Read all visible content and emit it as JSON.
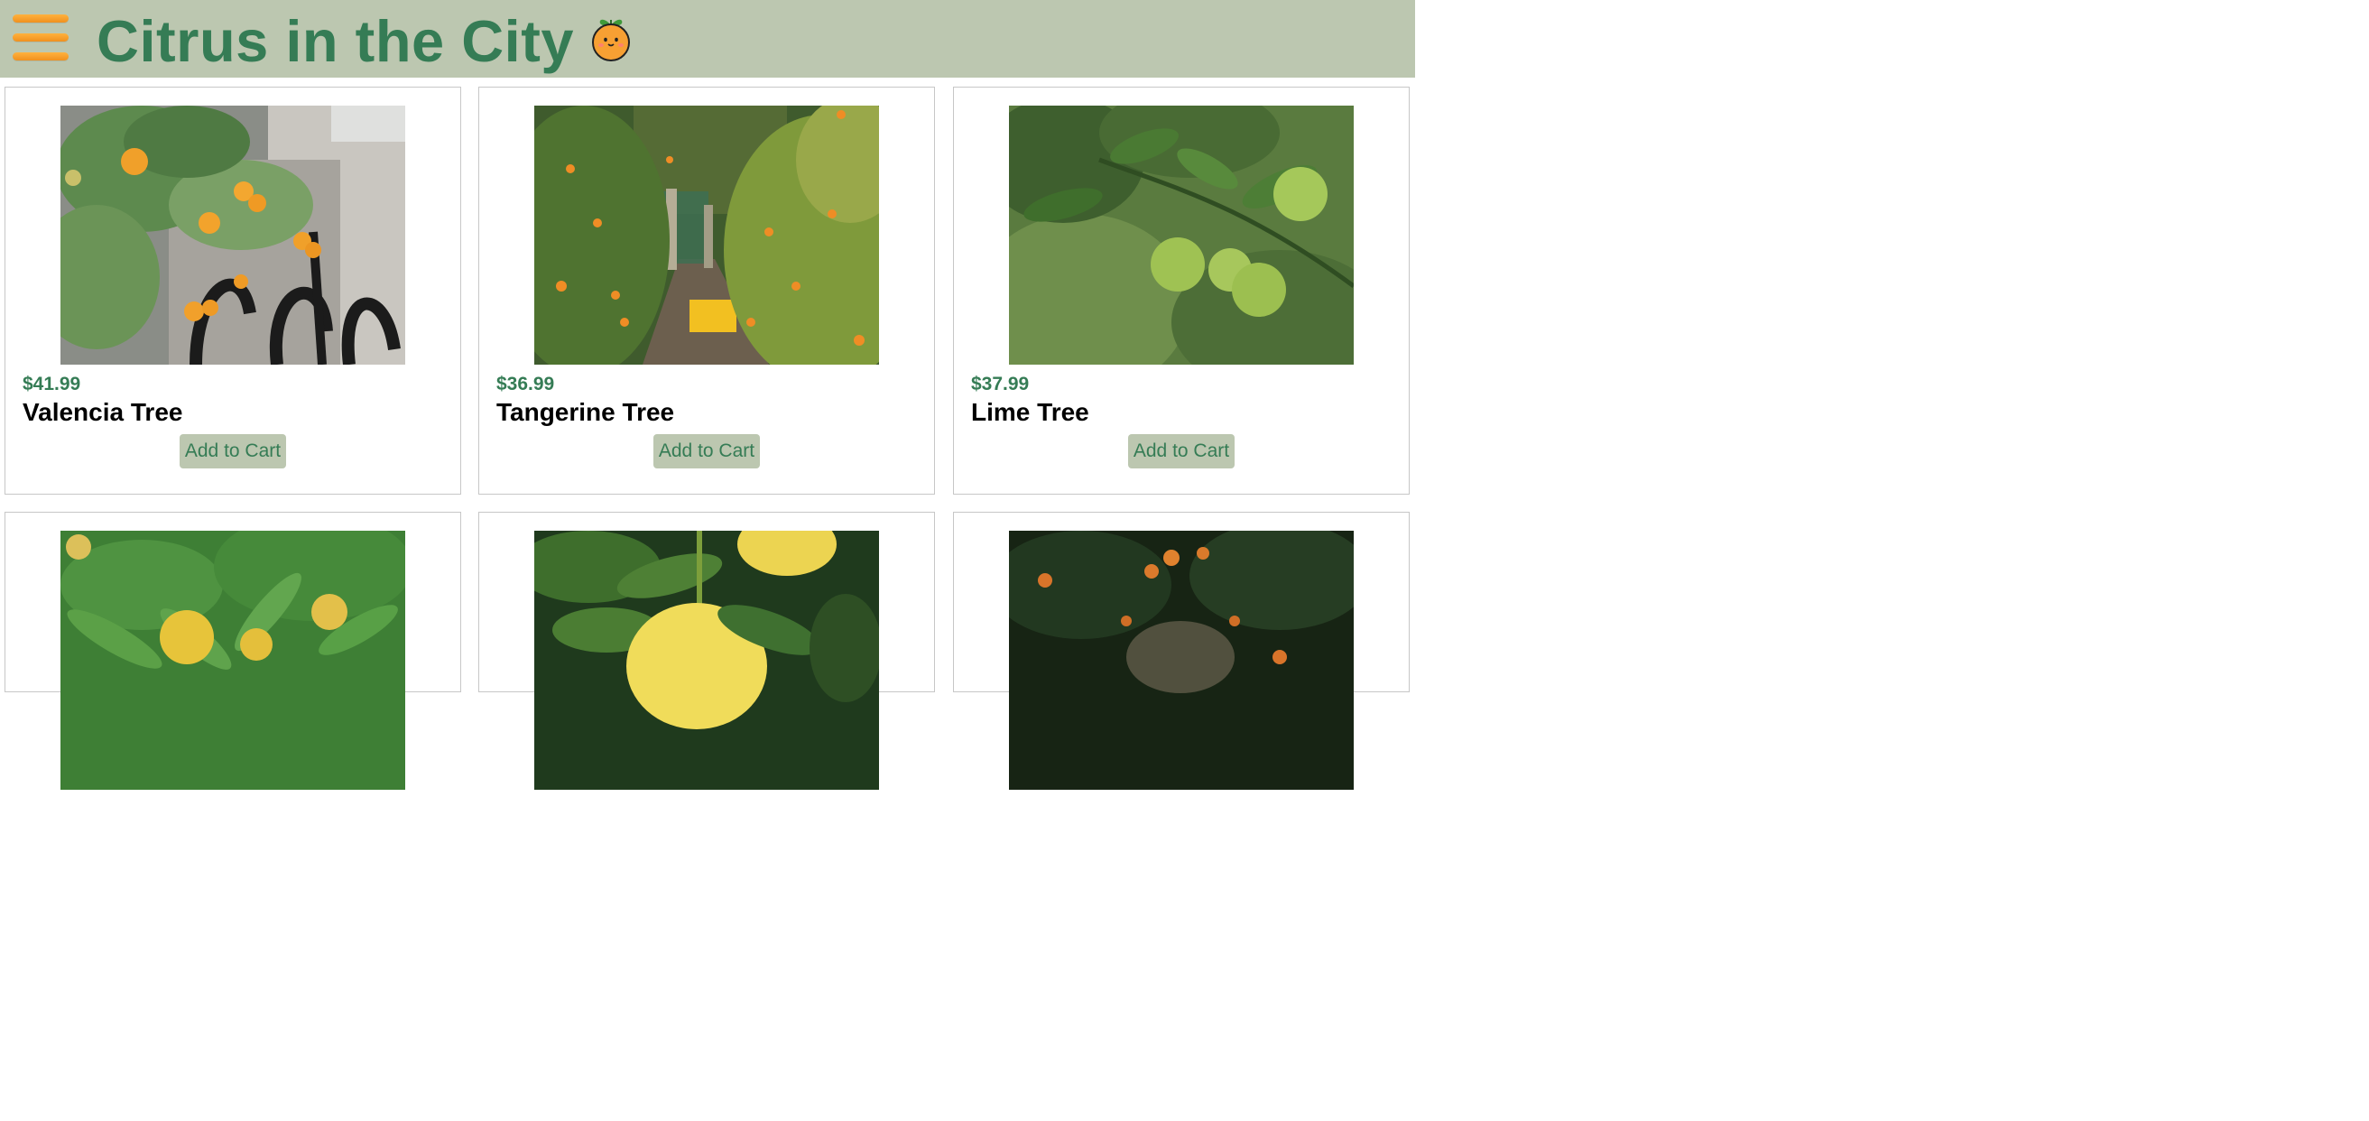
{
  "header": {
    "title": "Citrus in the City",
    "menu_icon": "hamburger-menu-icon",
    "mascot_icon": "orange-mascot-icon",
    "background": "#bcc7b0",
    "title_color": "#357c55",
    "menu_color": "#f7a030"
  },
  "products": [
    {
      "price": "$41.99",
      "name": "Valencia Tree",
      "button": "Add to Cart",
      "image": "valencia-tree-photo"
    },
    {
      "price": "$36.99",
      "name": "Tangerine Tree",
      "button": "Add to Cart",
      "image": "tangerine-orchard-photo"
    },
    {
      "price": "$37.99",
      "name": "Lime Tree",
      "button": "Add to Cart",
      "image": "lime-branch-photo"
    },
    {
      "image": "lemon-tree-photo"
    },
    {
      "image": "grapefruit-photo"
    },
    {
      "image": "dark-orange-grove-photo"
    }
  ],
  "colors": {
    "accent": "#357c55",
    "button_bg": "#bcc7b0",
    "card_border": "#c7c7c7"
  }
}
